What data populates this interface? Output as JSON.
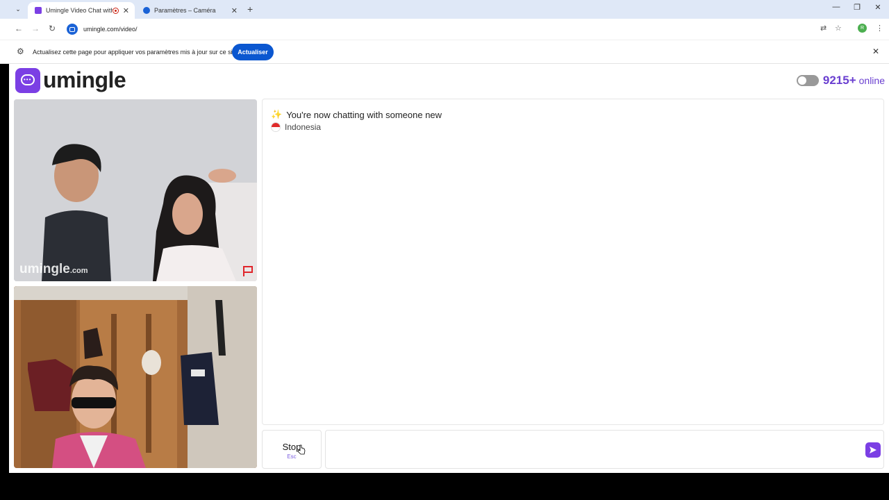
{
  "browser": {
    "tabs": [
      {
        "title": "Umingle Video Chat with St",
        "active": true,
        "recording": true
      },
      {
        "title": "Paramètres – Caméra",
        "active": false
      }
    ],
    "url": "umingle.com/video/",
    "profile_initial": "R"
  },
  "infobar": {
    "message": "Actualisez cette page pour appliquer vos paramètres mis à jour sur ce site",
    "button": "Actualiser"
  },
  "site": {
    "logo": "umingle",
    "online_count": "9215+",
    "online_label": "online"
  },
  "video": {
    "watermark_main": "umingle",
    "watermark_suffix": ".com"
  },
  "chat": {
    "status": "You're now chatting with someone new",
    "country": "Indonesia",
    "accent_color": "#7b3fe4"
  },
  "controls": {
    "stop_label": "Stop",
    "stop_key": "Esc",
    "message_placeholder": ""
  }
}
